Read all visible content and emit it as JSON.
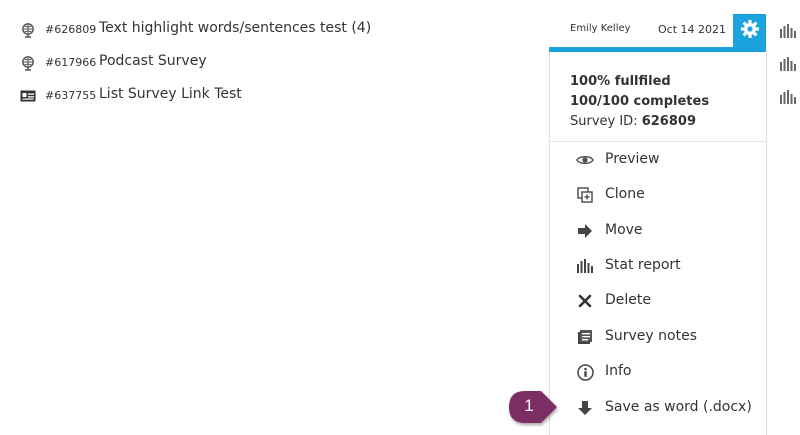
{
  "surveys": [
    {
      "id": "#626809",
      "title": "Text highlight words/sentences test (4)",
      "icon": "globe-icon"
    },
    {
      "id": "#617966",
      "title": "Podcast Survey",
      "icon": "globe-icon"
    },
    {
      "id": "#637755",
      "title": "List Survey Link Test",
      "icon": "id-card-icon"
    }
  ],
  "open_survey": {
    "user": "Emily Kelley",
    "date": "Oct 14 2021"
  },
  "dropdown": {
    "fulfilled": "100% fullfiled",
    "completes": "100/100 completes",
    "survey_id_label": "Survey ID:",
    "survey_id_value": "626809",
    "items": [
      {
        "label": "Preview",
        "icon": "eye-icon"
      },
      {
        "label": "Clone",
        "icon": "clone-icon"
      },
      {
        "label": "Move",
        "icon": "arrow-right-icon"
      },
      {
        "label": "Stat report",
        "icon": "bar-chart-icon"
      },
      {
        "label": "Delete",
        "icon": "close-icon"
      },
      {
        "label": "Survey notes",
        "icon": "notes-icon"
      },
      {
        "label": "Info",
        "icon": "info-icon"
      },
      {
        "label": "Save as word (.docx)",
        "icon": "arrow-down-icon"
      }
    ]
  },
  "callout": {
    "number": "1"
  },
  "colors": {
    "accent": "#1aa3dd",
    "callout": "#7a2d63",
    "icon": "#555555"
  }
}
